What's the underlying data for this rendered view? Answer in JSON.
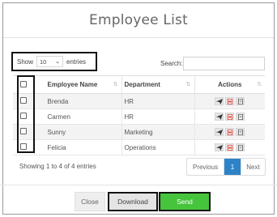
{
  "modal": {
    "title": "Employee List"
  },
  "length_control": {
    "show_label": "Show",
    "selected_value": "10",
    "suffix_label": "entries"
  },
  "search": {
    "label": "Search:",
    "value": ""
  },
  "table": {
    "headers": {
      "name": "Employee Name",
      "department": "Department",
      "actions": "Actions"
    },
    "rows": [
      {
        "name": "Brenda",
        "department": "HR"
      },
      {
        "name": "Carmen",
        "department": "HR"
      },
      {
        "name": "Sunny",
        "department": "Marketing"
      },
      {
        "name": "Felicia",
        "department": "Operations"
      }
    ],
    "action_icons": [
      "send-icon",
      "pdf-icon",
      "document-icon"
    ]
  },
  "info": "Showing 1 to 4 of 4 entries",
  "pagination": {
    "previous": "Previous",
    "current_page": "1",
    "next": "Next"
  },
  "footer": {
    "close_label": "Close",
    "download_label": "Download",
    "send_label": "Send"
  },
  "colors": {
    "send_button": "#46c43c",
    "active_page": "#2e83c8",
    "pdf_icon": "#d9342b"
  }
}
